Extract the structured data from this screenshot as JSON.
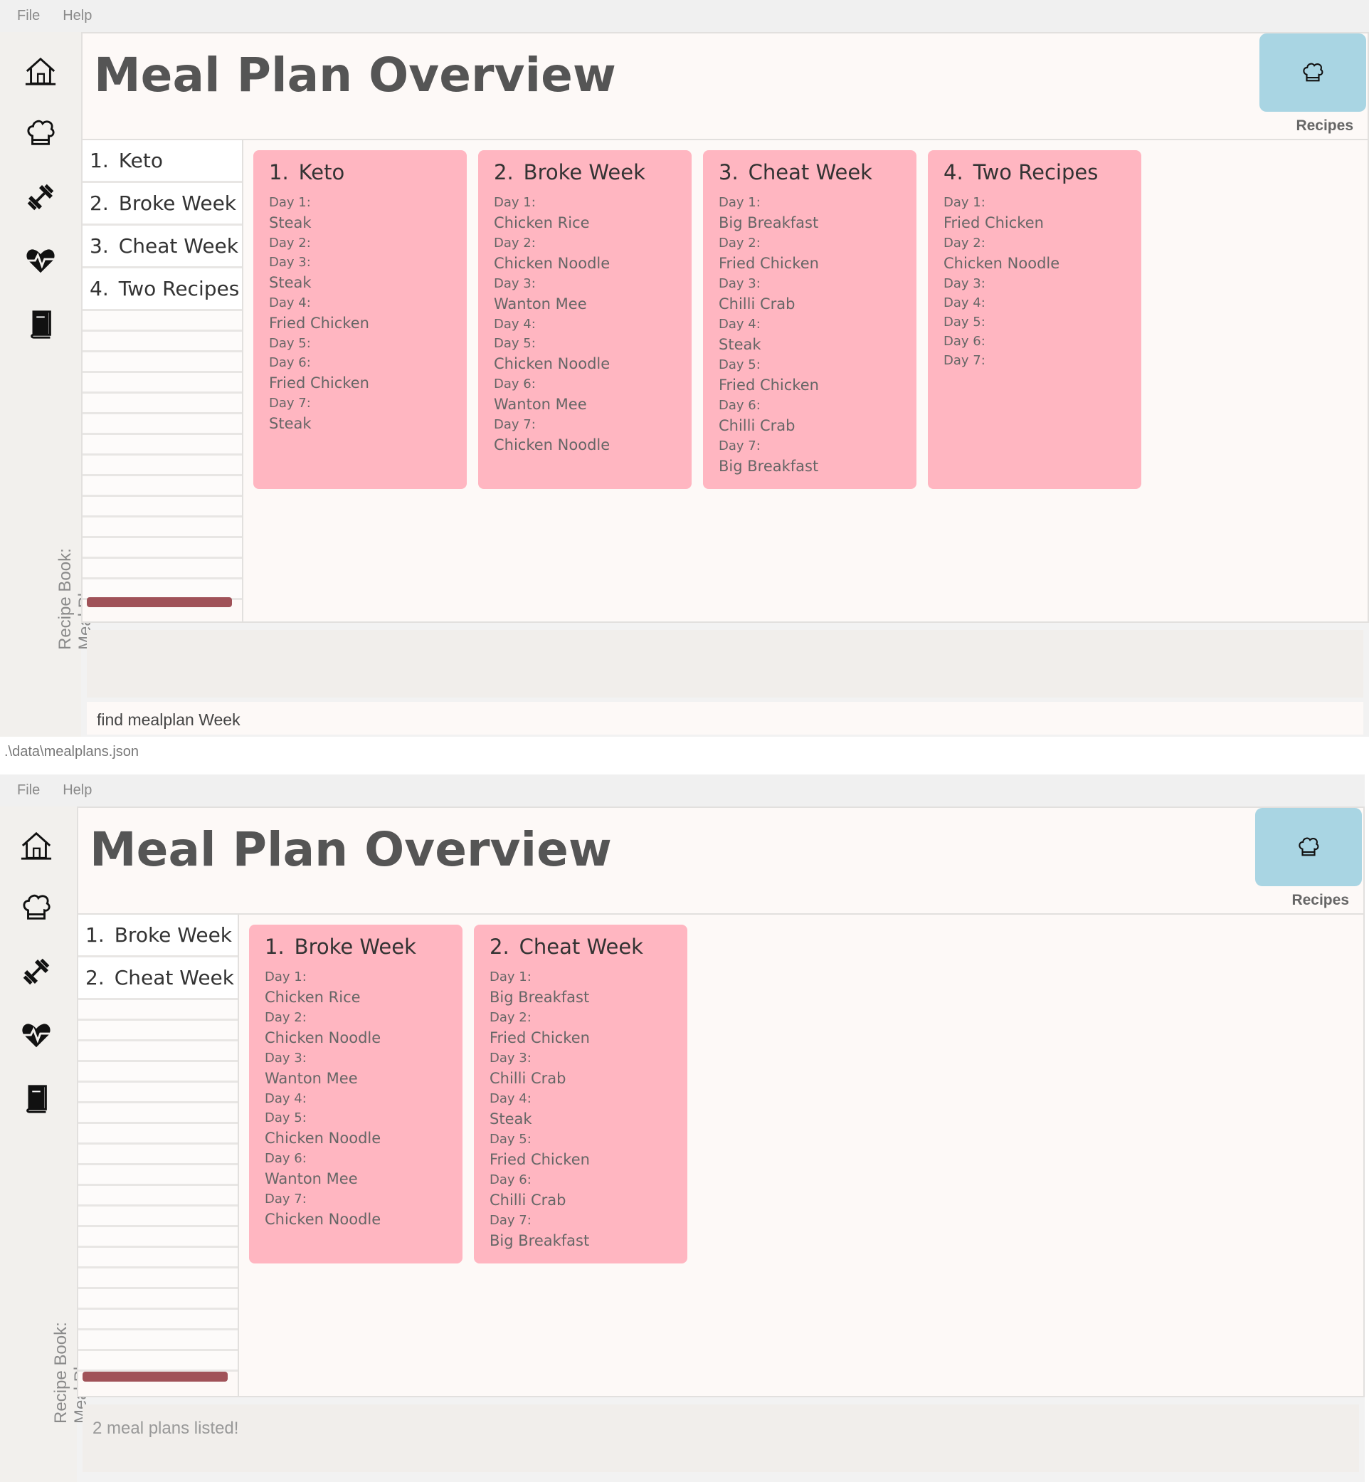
{
  "app": {
    "menu": [
      "File",
      "Help"
    ],
    "sidebar_label_line1": "Recipe Book:",
    "sidebar_label_line2": "Meal Plans",
    "page_title": "Meal Plan Overview",
    "recipes_button_label": "Recipes",
    "icons": [
      "home-icon",
      "chef-hat-icon",
      "dumbbell-icon",
      "heartbeat-icon",
      "book-icon"
    ]
  },
  "screen1": {
    "list": [
      {
        "num": "1.",
        "name": "Keto"
      },
      {
        "num": "2.",
        "name": "Broke Week"
      },
      {
        "num": "3.",
        "name": "Cheat Week"
      },
      {
        "num": "4.",
        "name": "Two Recipes"
      }
    ],
    "cards": [
      {
        "num": "1.",
        "name": "Keto",
        "days": [
          {
            "day": "Day 1:",
            "recipes": [
              "Steak"
            ]
          },
          {
            "day": "Day 2:",
            "recipes": []
          },
          {
            "day": "Day 3:",
            "recipes": [
              "Steak"
            ]
          },
          {
            "day": "Day 4:",
            "recipes": [
              "Fried Chicken"
            ]
          },
          {
            "day": "Day 5:",
            "recipes": []
          },
          {
            "day": "Day 6:",
            "recipes": [
              "Fried Chicken"
            ]
          },
          {
            "day": "Day 7:",
            "recipes": [
              "Steak"
            ]
          }
        ]
      },
      {
        "num": "2.",
        "name": "Broke Week",
        "days": [
          {
            "day": "Day 1:",
            "recipes": [
              "Chicken Rice"
            ]
          },
          {
            "day": "Day 2:",
            "recipes": [
              "Chicken Noodle"
            ]
          },
          {
            "day": "Day 3:",
            "recipes": [
              "Wanton Mee"
            ]
          },
          {
            "day": "Day 4:",
            "recipes": []
          },
          {
            "day": "Day 5:",
            "recipes": [
              "Chicken Noodle"
            ]
          },
          {
            "day": "Day 6:",
            "recipes": [
              "Wanton Mee"
            ]
          },
          {
            "day": "Day 7:",
            "recipes": [
              "Chicken Noodle"
            ]
          }
        ]
      },
      {
        "num": "3.",
        "name": "Cheat Week",
        "days": [
          {
            "day": "Day 1:",
            "recipes": [
              "Big Breakfast"
            ]
          },
          {
            "day": "Day 2:",
            "recipes": [
              "Fried Chicken"
            ]
          },
          {
            "day": "Day 3:",
            "recipes": [
              "Chilli Crab"
            ]
          },
          {
            "day": "Day 4:",
            "recipes": [
              "Steak"
            ]
          },
          {
            "day": "Day 5:",
            "recipes": [
              "Fried Chicken"
            ]
          },
          {
            "day": "Day 6:",
            "recipes": [
              "Chilli Crab"
            ]
          },
          {
            "day": "Day 7:",
            "recipes": [
              "Big Breakfast"
            ]
          }
        ]
      },
      {
        "num": "4.",
        "name": "Two Recipes",
        "days": [
          {
            "day": "Day 1:",
            "recipes": [
              "Fried Chicken"
            ]
          },
          {
            "day": "Day 2:",
            "recipes": [
              "Chicken Noodle"
            ]
          },
          {
            "day": "Day 3:",
            "recipes": []
          },
          {
            "day": "Day 4:",
            "recipes": []
          },
          {
            "day": "Day 5:",
            "recipes": []
          },
          {
            "day": "Day 6:",
            "recipes": []
          },
          {
            "day": "Day 7:",
            "recipes": []
          }
        ]
      }
    ],
    "result_text": "",
    "command_text": "find mealplan Week",
    "status_path": ".\\data\\mealplans.json"
  },
  "screen2": {
    "list": [
      {
        "num": "1.",
        "name": "Broke Week"
      },
      {
        "num": "2.",
        "name": "Cheat Week"
      }
    ],
    "cards": [
      {
        "num": "1.",
        "name": "Broke Week",
        "days": [
          {
            "day": "Day 1:",
            "recipes": [
              "Chicken Rice"
            ]
          },
          {
            "day": "Day 2:",
            "recipes": [
              "Chicken Noodle"
            ]
          },
          {
            "day": "Day 3:",
            "recipes": [
              "Wanton Mee"
            ]
          },
          {
            "day": "Day 4:",
            "recipes": []
          },
          {
            "day": "Day 5:",
            "recipes": [
              "Chicken Noodle"
            ]
          },
          {
            "day": "Day 6:",
            "recipes": [
              "Wanton Mee"
            ]
          },
          {
            "day": "Day 7:",
            "recipes": [
              "Chicken Noodle"
            ]
          }
        ]
      },
      {
        "num": "2.",
        "name": "Cheat Week",
        "days": [
          {
            "day": "Day 1:",
            "recipes": [
              "Big Breakfast"
            ]
          },
          {
            "day": "Day 2:",
            "recipes": [
              "Fried Chicken"
            ]
          },
          {
            "day": "Day 3:",
            "recipes": [
              "Chilli Crab"
            ]
          },
          {
            "day": "Day 4:",
            "recipes": [
              "Steak"
            ]
          },
          {
            "day": "Day 5:",
            "recipes": [
              "Fried Chicken"
            ]
          },
          {
            "day": "Day 6:",
            "recipes": [
              "Chilli Crab"
            ]
          },
          {
            "day": "Day 7:",
            "recipes": [
              "Big Breakfast"
            ]
          }
        ]
      }
    ],
    "result_text": "2 meal plans listed!"
  }
}
